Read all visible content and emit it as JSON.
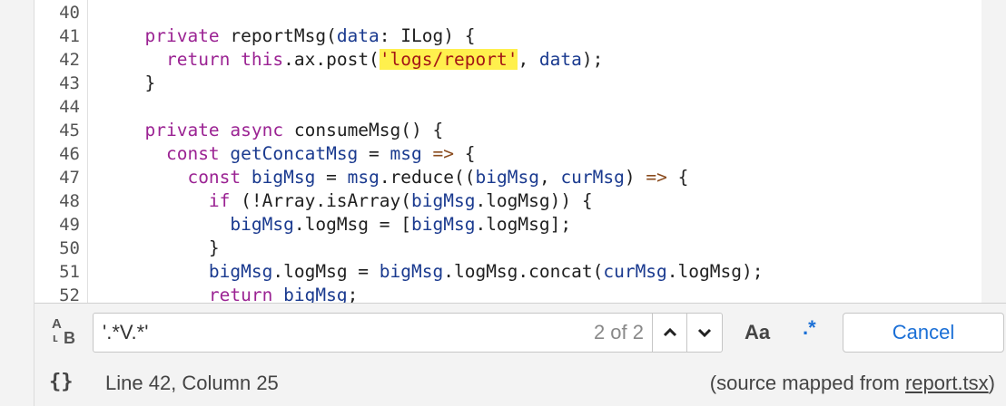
{
  "editor": {
    "line_numbers": [
      "40",
      "41",
      "42",
      "43",
      "44",
      "45",
      "46",
      "47",
      "48",
      "49",
      "50",
      "51",
      "52"
    ],
    "lines": [
      {
        "indent": "",
        "tokens": []
      },
      {
        "indent": "  ",
        "tokens": [
          [
            "kw",
            "private"
          ],
          [
            "fn",
            " reportMsg("
          ],
          [
            "var",
            "data"
          ],
          [
            "fn",
            ": ILog) {"
          ]
        ]
      },
      {
        "indent": "    ",
        "tokens": [
          [
            "kw",
            "return"
          ],
          [
            "fn",
            " "
          ],
          [
            "kw",
            "this"
          ],
          [
            "fn",
            ".ax.post("
          ],
          [
            "str hl",
            "'logs/report'"
          ],
          [
            "fn",
            ", "
          ],
          [
            "var",
            "data"
          ],
          [
            "fn",
            ");"
          ]
        ]
      },
      {
        "indent": "  ",
        "tokens": [
          [
            "fn",
            "}"
          ]
        ]
      },
      {
        "indent": "",
        "tokens": []
      },
      {
        "indent": "  ",
        "tokens": [
          [
            "kw",
            "private"
          ],
          [
            "fn",
            " "
          ],
          [
            "kw",
            "async"
          ],
          [
            "fn",
            " consumeMsg() {"
          ]
        ]
      },
      {
        "indent": "    ",
        "tokens": [
          [
            "kw",
            "const"
          ],
          [
            "fn",
            " "
          ],
          [
            "var",
            "getConcatMsg"
          ],
          [
            "fn",
            " = "
          ],
          [
            "var",
            "msg"
          ],
          [
            "fn",
            " "
          ],
          [
            "op",
            "=>"
          ],
          [
            "fn",
            " {"
          ]
        ]
      },
      {
        "indent": "      ",
        "tokens": [
          [
            "kw",
            "const"
          ],
          [
            "fn",
            " "
          ],
          [
            "var",
            "bigMsg"
          ],
          [
            "fn",
            " = "
          ],
          [
            "var",
            "msg"
          ],
          [
            "fn",
            ".reduce(("
          ],
          [
            "var",
            "bigMsg"
          ],
          [
            "fn",
            ", "
          ],
          [
            "var",
            "curMsg"
          ],
          [
            "fn",
            ") "
          ],
          [
            "op",
            "=>"
          ],
          [
            "fn",
            " {"
          ]
        ]
      },
      {
        "indent": "        ",
        "tokens": [
          [
            "kw",
            "if"
          ],
          [
            "fn",
            " (!Array.isArray("
          ],
          [
            "var",
            "bigMsg"
          ],
          [
            "fn",
            ".logMsg)) {"
          ]
        ]
      },
      {
        "indent": "          ",
        "tokens": [
          [
            "var",
            "bigMsg"
          ],
          [
            "fn",
            ".logMsg = ["
          ],
          [
            "var",
            "bigMsg"
          ],
          [
            "fn",
            ".logMsg];"
          ]
        ]
      },
      {
        "indent": "        ",
        "tokens": [
          [
            "fn",
            "}"
          ]
        ]
      },
      {
        "indent": "        ",
        "tokens": [
          [
            "var",
            "bigMsg"
          ],
          [
            "fn",
            ".logMsg = "
          ],
          [
            "var",
            "bigMsg"
          ],
          [
            "fn",
            ".logMsg.concat("
          ],
          [
            "var",
            "curMsg"
          ],
          [
            "fn",
            ".logMsg);"
          ]
        ]
      },
      {
        "indent": "        ",
        "tokens": [
          [
            "kw",
            "return"
          ],
          [
            "fn",
            " "
          ],
          [
            "var",
            "bigMsg"
          ],
          [
            "fn",
            ";"
          ]
        ]
      }
    ]
  },
  "search": {
    "value": "'.*V.*'",
    "match_count": "2 of 2",
    "case_label": "Aa",
    "regex_label": ".*",
    "cancel_label": "Cancel",
    "icons": {
      "case": "match-case-icon",
      "prev": "chevron-up-icon",
      "next": "chevron-down-icon"
    }
  },
  "status": {
    "braces": "{}",
    "cursor_position": "Line 42, Column 25",
    "source_prefix": "(source mapped from ",
    "source_file": "report.tsx",
    "source_suffix": ")"
  }
}
